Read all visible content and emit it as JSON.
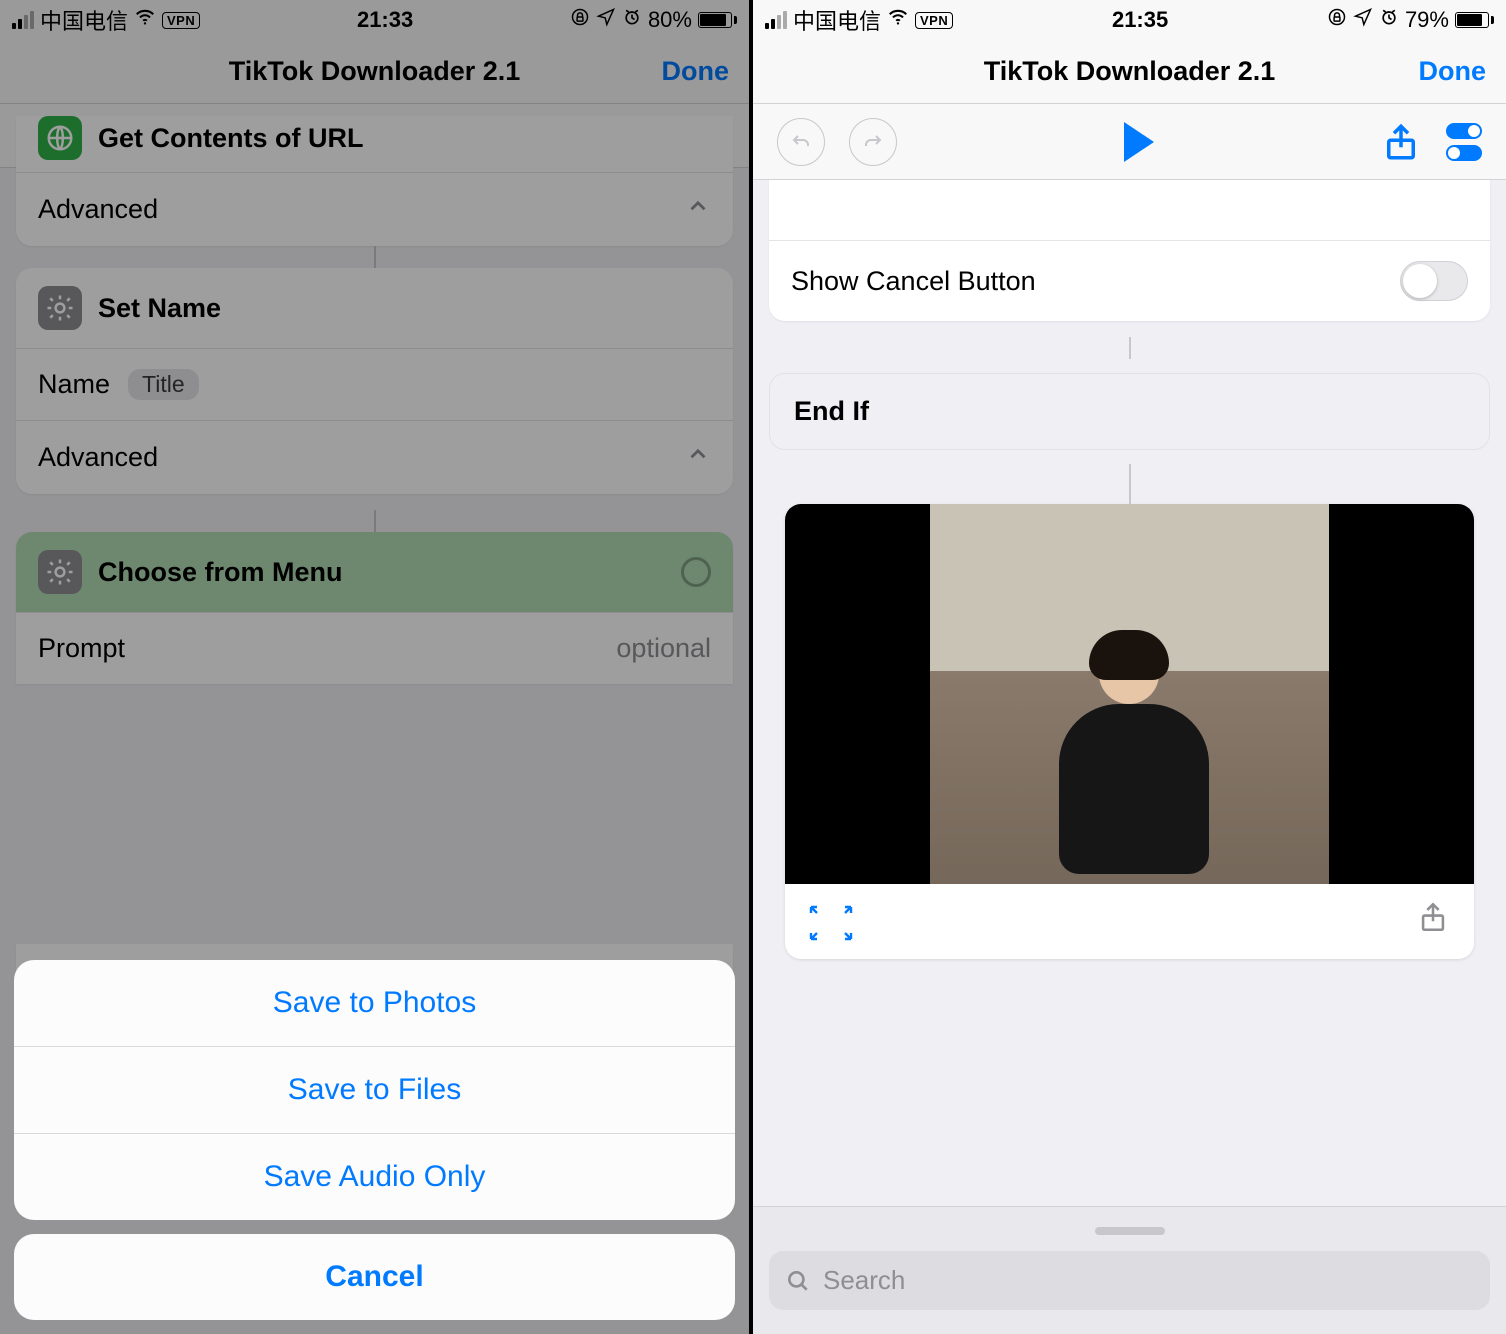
{
  "left": {
    "status": {
      "carrier": "中国电信",
      "vpn": "VPN",
      "time": "21:33",
      "battery_pct": "80%",
      "battery_fill": 80
    },
    "nav": {
      "title": "TikTok Downloader 2.1",
      "done": "Done"
    },
    "actions": {
      "get_contents": "Get Contents of URL",
      "advanced": "Advanced",
      "set_name": "Set Name",
      "name_label": "Name",
      "name_token": "Title",
      "choose_menu": "Choose from Menu",
      "prompt_label": "Prompt",
      "prompt_placeholder": "optional",
      "menu_peek": "Save to Photos"
    },
    "sheet": {
      "opt1": "Save to Photos",
      "opt2": "Save to Files",
      "opt3": "Save Audio Only",
      "cancel": "Cancel"
    }
  },
  "right": {
    "status": {
      "carrier": "中国电信",
      "vpn": "VPN",
      "time": "21:35",
      "battery_pct": "79%",
      "battery_fill": 79
    },
    "nav": {
      "title": "TikTok Downloader 2.1",
      "done": "Done"
    },
    "rows": {
      "show_cancel": "Show Cancel Button",
      "end_if": "End If"
    },
    "search": {
      "placeholder": "Search"
    }
  }
}
